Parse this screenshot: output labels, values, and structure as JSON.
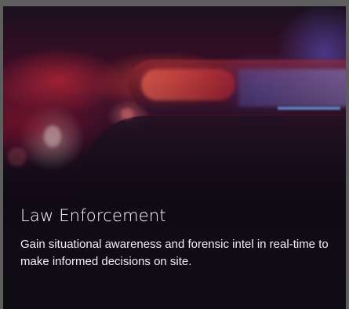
{
  "card": {
    "title": "Law Enforcement",
    "description": "Gain situational awareness and forensic intel in real-time to make informed decisions on site."
  }
}
